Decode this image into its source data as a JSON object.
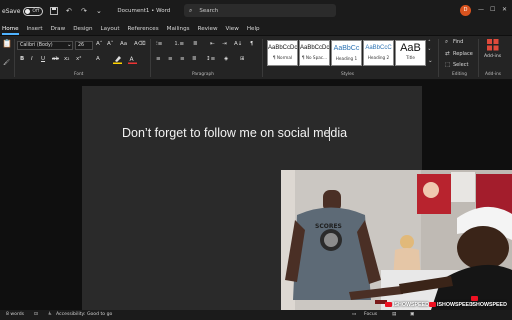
{
  "titlebar": {
    "autosave_label": "eSave",
    "autosave_state": "Off",
    "doc_title": "Document1 • Word",
    "search_placeholder": "Search",
    "avatar_initial": "D"
  },
  "tabs": [
    "Home",
    "Insert",
    "Draw",
    "Design",
    "Layout",
    "References",
    "Mailings",
    "Review",
    "View",
    "Help"
  ],
  "ribbon": {
    "font_name": "Calibri (Body)",
    "font_size": "26",
    "groups": {
      "font": "Font",
      "paragraph": "Paragraph",
      "styles": "Styles",
      "editing": "Editing",
      "addins": "Add-ins"
    },
    "styles": [
      {
        "sample": "AaBbCcDc",
        "name": "¶ Normal"
      },
      {
        "sample": "AaBbCcDc",
        "name": "¶ No Spac..."
      },
      {
        "sample": "AaBbCc",
        "name": "Heading 1"
      },
      {
        "sample": "AaBbCcC",
        "name": "Heading 2"
      },
      {
        "sample": "AaB",
        "name": "Title"
      }
    ],
    "find_label": "Find",
    "replace_label": "Replace",
    "select_label": "Select",
    "addins_label": "Add-ins"
  },
  "document": {
    "text": "Don’t forget to follow me on social media"
  },
  "webcam": {
    "shirt_text": "SCORES",
    "watermarks": [
      "ISHOWSPEED",
      "ISHOWSPEED",
      "ISHOWSPEED"
    ]
  },
  "statusbar": {
    "word_count": "8 words",
    "accessibility": "Accessibility: Good to go",
    "focus": "Focus"
  },
  "colors": {
    "accent": "#4fb3ff",
    "avatar": "#d9531e",
    "addins_icon": "#e04a3b"
  }
}
